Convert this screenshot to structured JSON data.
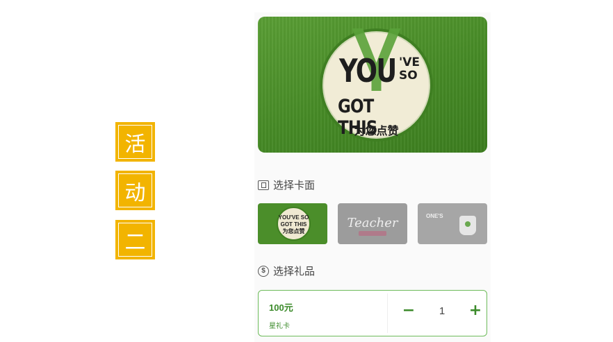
{
  "left_tags": [
    "活",
    "动",
    "二"
  ],
  "hero": {
    "badge_you": "YOU",
    "badge_ve": "'VE",
    "badge_so": "SO",
    "badge_got": "GOT THIS",
    "badge_cn": "为您点赞"
  },
  "select_card": {
    "title": "选择卡面",
    "thumbs": [
      {
        "id": "you-got-this",
        "text": "YOU'VE SO GOT THIS 为您点赞"
      },
      {
        "id": "teacher",
        "text": "Teacher"
      },
      {
        "id": "ones",
        "text": "ONE'S"
      }
    ]
  },
  "select_gift": {
    "title": "选择礼品",
    "icon_text": "$",
    "price": "100元",
    "name": "星礼卡",
    "minus": "−",
    "quantity": "1",
    "plus": "+"
  },
  "colors": {
    "tag_bg": "#f2b400",
    "brand_green": "#468a26",
    "accent_green": "#3b8a2a"
  }
}
